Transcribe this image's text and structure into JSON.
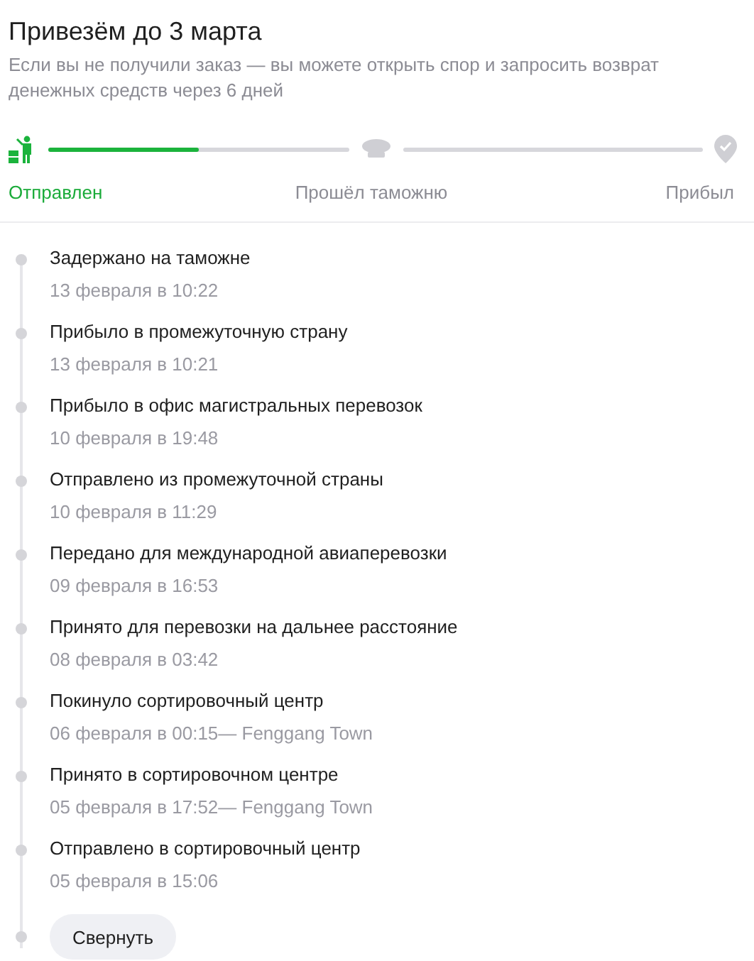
{
  "title": "Привезём до 3 марта",
  "subtitle": "Если вы не получили заказ — вы можете открыть спор и запросить возврат денежных средств через 6 дней",
  "progress": {
    "steps": [
      {
        "kind": "dispatch",
        "label": "Отправлен",
        "reached": true
      },
      {
        "kind": "customs",
        "label": "Прошёл таможню",
        "reached": false
      },
      {
        "kind": "arrival",
        "label": "Прибыл",
        "reached": false
      }
    ],
    "segments": [
      {
        "level": 0.5
      }
    ]
  },
  "events": [
    {
      "status": "Задержано на таможне",
      "time": "13 февраля в 10:22"
    },
    {
      "status": "Прибыло в промежуточную страну",
      "time": "13 февраля в 10:21"
    },
    {
      "status": "Прибыло в офис магистральных перевозок",
      "time": "10 февраля в 19:48"
    },
    {
      "status": "Отправлено из промежуточной страны",
      "time": "10 февраля в 11:29"
    },
    {
      "status": "Передано для международной авиаперевозки",
      "time": "09 февраля в 16:53"
    },
    {
      "status": "Принято для перевозки на дальнее расстояние",
      "time": "08 февраля в 03:42"
    },
    {
      "status": "Покинуло сортировочный центр",
      "time": "06 февраля в 00:15— Fenggang Town"
    },
    {
      "status": "Принято в сортировочном центре",
      "time": "05 февраля в 17:52— Fenggang Town"
    },
    {
      "status": "Отправлено в сортировочный центр",
      "time": "05 февраля в 15:06"
    }
  ],
  "collapse_button": "Свернуть"
}
